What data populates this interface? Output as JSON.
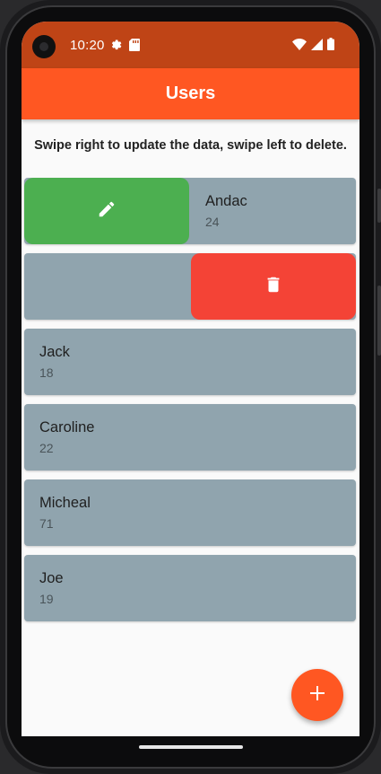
{
  "status_bar": {
    "time": "10:20",
    "left_icons": [
      "settings-gear-icon",
      "sd-card-icon"
    ],
    "right_icons": [
      "wifi-icon",
      "signal-icon",
      "battery-icon"
    ]
  },
  "app_bar": {
    "title": "Users"
  },
  "instruction": "Swipe right to update the data, swipe left to delete.",
  "users": [
    {
      "name": "Andac",
      "age": "24",
      "state": "swiped-right",
      "action_icon": "edit-pencil-icon"
    },
    {
      "name": "",
      "age": "",
      "state": "swiped-left",
      "action_icon": "delete-trash-icon"
    },
    {
      "name": "Jack",
      "age": "18",
      "state": "normal"
    },
    {
      "name": "Caroline",
      "age": "22",
      "state": "normal"
    },
    {
      "name": "Micheal",
      "age": "71",
      "state": "normal"
    },
    {
      "name": "Joe",
      "age": "19",
      "state": "normal"
    }
  ],
  "fab": {
    "icon": "add-plus-icon"
  },
  "colors": {
    "status_bar": "#bf4416",
    "app_bar": "#ff5722",
    "card": "#90a4ae",
    "edit_action": "#4caf50",
    "delete_action": "#f44336",
    "fab": "#ff5722"
  }
}
